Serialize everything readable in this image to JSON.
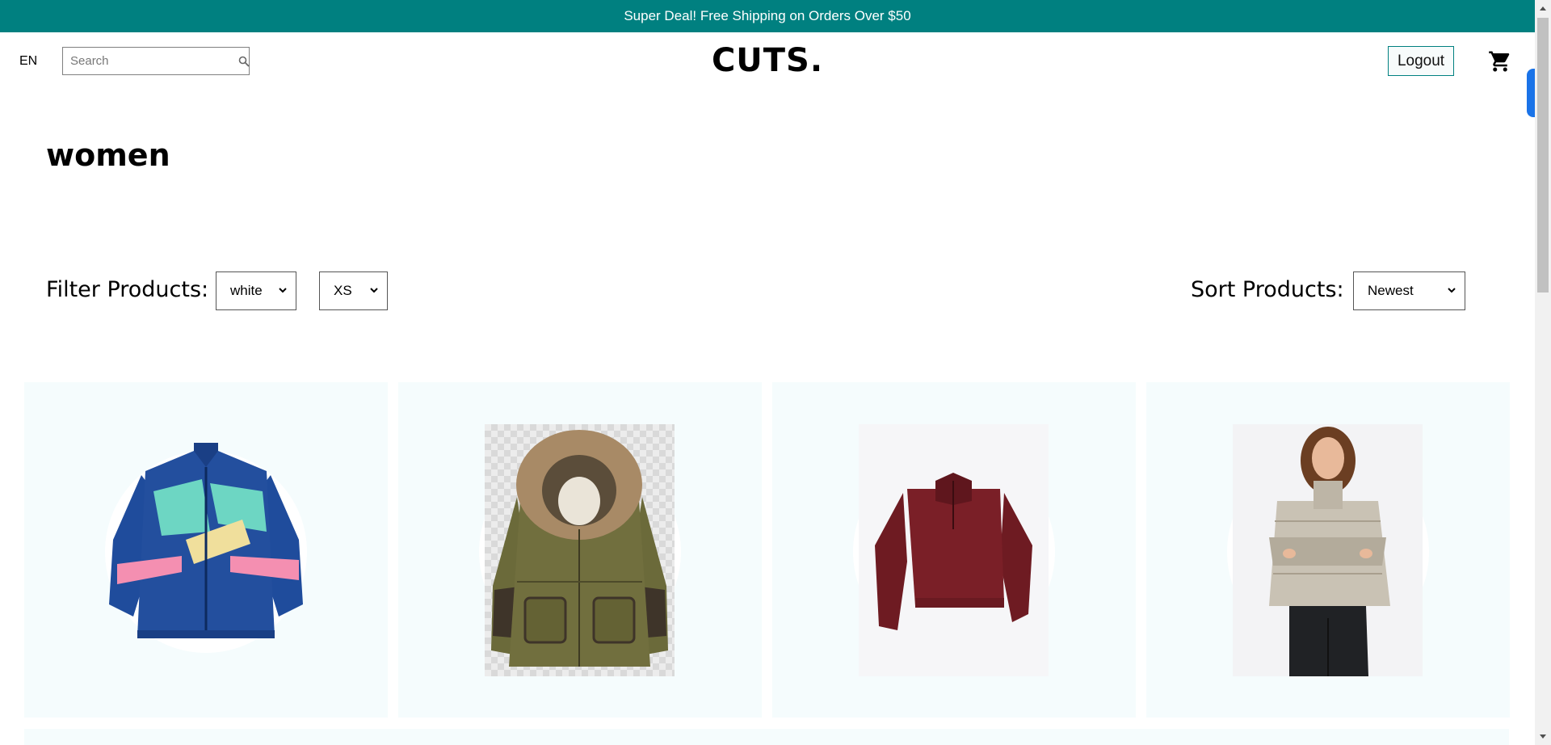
{
  "announcement": {
    "text": "Super Deal! Free Shipping on Orders Over $50"
  },
  "navbar": {
    "language": "EN",
    "search": {
      "placeholder": "Search",
      "value": "",
      "icon": "search-icon"
    },
    "logo": "CUTS.",
    "logout_label": "Logout",
    "cart_icon": "shopping-cart-icon"
  },
  "page": {
    "title": "women"
  },
  "filters": {
    "label": "Filter Products:",
    "color": {
      "selected": "white"
    },
    "size": {
      "selected": "XS"
    }
  },
  "sort": {
    "label": "Sort Products:",
    "selected": "Newest"
  },
  "products": [
    {
      "name": "blue-windbreaker-jacket"
    },
    {
      "name": "olive-fur-hood-parka"
    },
    {
      "name": "burgundy-fleece-pullover"
    },
    {
      "name": "beige-puffer-jacket"
    }
  ],
  "colors": {
    "accent": "#008080",
    "card_background": "#f5fcfd"
  }
}
